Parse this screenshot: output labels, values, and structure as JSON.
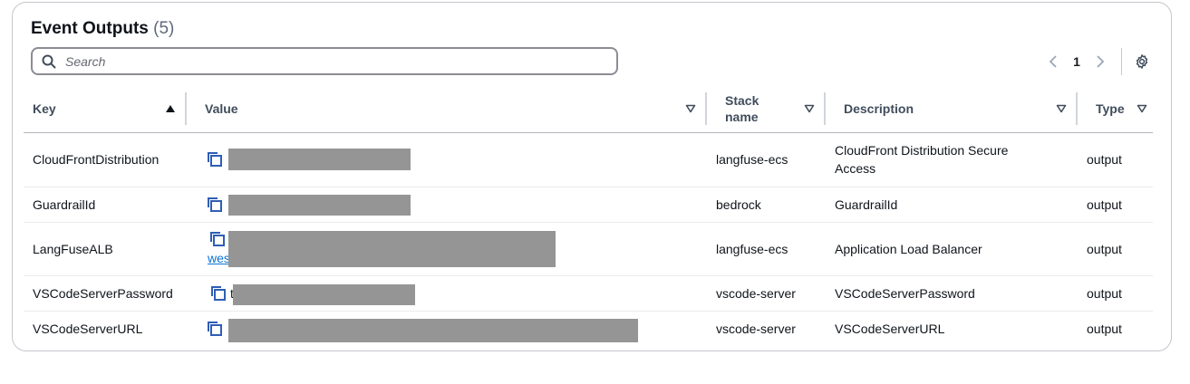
{
  "header": {
    "title": "Event Outputs",
    "count": "(5)"
  },
  "search": {
    "placeholder": "Search"
  },
  "pagination": {
    "current_page": "1"
  },
  "table": {
    "columns": [
      {
        "label": "Key",
        "sort": "ascending"
      },
      {
        "label": "Value",
        "sort": "none"
      },
      {
        "label": "Stack name",
        "sort": "none"
      },
      {
        "label": "Description",
        "sort": "none"
      },
      {
        "label": "Type",
        "sort": "none"
      }
    ],
    "rows": [
      {
        "key": "CloudFrontDistribution",
        "value_visible": "",
        "stack": "langfuse-ecs",
        "description": "CloudFront Distribution Secure Access",
        "type": "output"
      },
      {
        "key": "GuardrailId",
        "value_visible": "",
        "stack": "bedrock",
        "description": "GuardrailId",
        "type": "output"
      },
      {
        "key": "LangFuseALB",
        "value_visible": "wes",
        "stack": "langfuse-ecs",
        "description": "Application Load Balancer",
        "type": "output"
      },
      {
        "key": "VSCodeServerPassword",
        "value_visible": "t",
        "stack": "vscode-server",
        "description": "VSCodeServerPassword",
        "type": "output"
      },
      {
        "key": "VSCodeServerURL",
        "value_visible": "",
        "stack": "vscode-server",
        "description": "VSCodeServerURL",
        "type": "output"
      }
    ]
  },
  "colors": {
    "accent": "#0972d3",
    "copy_icon": "#2f5eb5",
    "redaction": "#959595"
  },
  "icons": {
    "search": "search-icon",
    "prev": "chevron-left-icon",
    "next": "chevron-right-icon",
    "settings": "gear-icon",
    "sort_asc": "caret-up-filled-icon",
    "sort_none": "caret-down-outline-icon",
    "copy": "copy-icon"
  }
}
